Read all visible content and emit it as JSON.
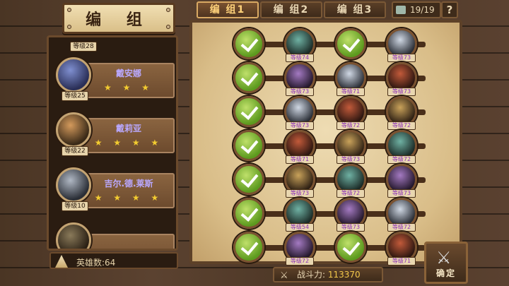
{
  "title": "编 组",
  "tabs": [
    {
      "label": "编 组1",
      "active": true
    },
    {
      "label": "编 组2",
      "active": false
    },
    {
      "label": "编 组3",
      "active": false
    }
  ],
  "capacity": "19/19",
  "help": "?",
  "hero_list": {
    "top_partial_level": "等级28",
    "items": [
      {
        "name": "戴安娜",
        "stars": "★ ★ ★",
        "level": "等级25"
      },
      {
        "name": "戴莉亚",
        "stars": "★ ★ ★ ★",
        "level": "等级22"
      },
      {
        "name": "吉尔.德.莱斯",
        "stars": "★ ★ ★ ★",
        "level": "等级10"
      }
    ],
    "count_label": "英雄数:64"
  },
  "formation": {
    "rows": [
      {
        "slots": [
          {
            "type": "check"
          },
          {
            "type": "hero",
            "level": "等级74"
          },
          {
            "type": "check"
          },
          {
            "type": "hero",
            "level": "等级73"
          }
        ]
      },
      {
        "slots": [
          {
            "type": "check"
          },
          {
            "type": "hero",
            "level": "等级73"
          },
          {
            "type": "hero",
            "level": "等级71"
          },
          {
            "type": "hero",
            "level": "等级73"
          }
        ]
      },
      {
        "slots": [
          {
            "type": "check"
          },
          {
            "type": "hero",
            "level": "等级73"
          },
          {
            "type": "hero",
            "level": "等级72"
          },
          {
            "type": "hero",
            "level": "等级72"
          }
        ]
      },
      {
        "slots": [
          {
            "type": "check"
          },
          {
            "type": "hero",
            "level": "等级71"
          },
          {
            "type": "hero",
            "level": "等级73"
          },
          {
            "type": "hero",
            "level": "等级72"
          }
        ]
      },
      {
        "slots": [
          {
            "type": "check"
          },
          {
            "type": "hero",
            "level": "等级73"
          },
          {
            "type": "hero",
            "level": "等级72"
          },
          {
            "type": "hero",
            "level": "等级73"
          }
        ]
      },
      {
        "slots": [
          {
            "type": "check"
          },
          {
            "type": "hero",
            "level": "等级54"
          },
          {
            "type": "hero",
            "level": "等级73"
          },
          {
            "type": "hero",
            "level": "等级72"
          }
        ]
      },
      {
        "slots": [
          {
            "type": "check"
          },
          {
            "type": "hero",
            "level": "等级72"
          },
          {
            "type": "check"
          },
          {
            "type": "hero",
            "level": "等级71"
          }
        ]
      }
    ]
  },
  "power": {
    "label": "战斗力:",
    "value": "113370"
  },
  "confirm_label": "确定"
}
